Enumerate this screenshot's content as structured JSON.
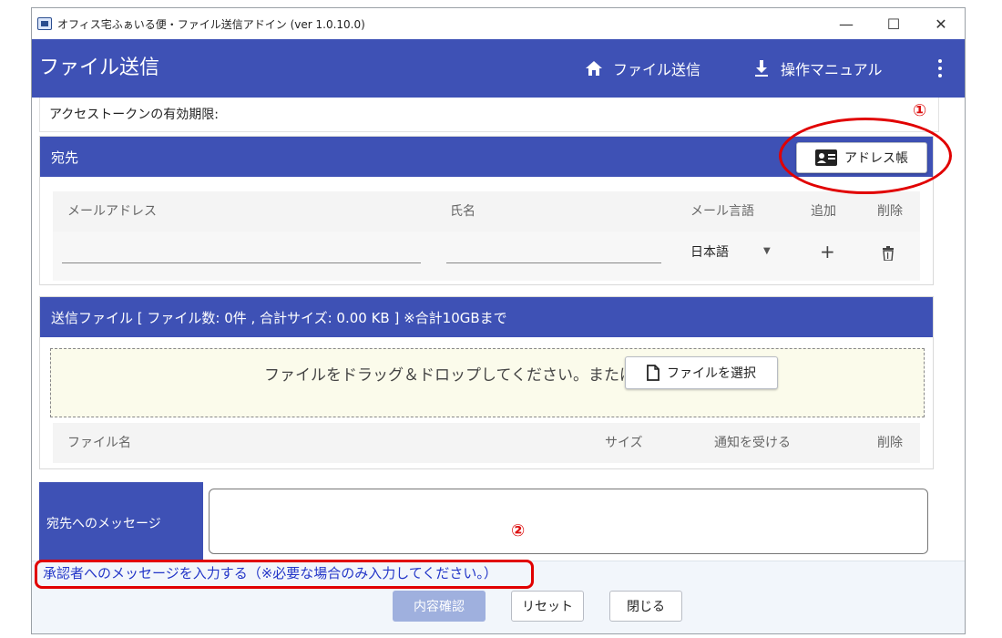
{
  "window": {
    "title": "オフィス宅ふぁいる便・ファイル送信アドイン (ver 1.0.10.0)",
    "controls": {
      "minimize": "—",
      "maximize": "☐",
      "close": "✕"
    }
  },
  "appbar": {
    "title": "ファイル送信",
    "nav": [
      {
        "label": "ファイル送信",
        "icon": "home-icon"
      },
      {
        "label": "操作マニュアル",
        "icon": "download-icon"
      }
    ],
    "menu_icon": "more-vert-icon"
  },
  "token": {
    "label": "アクセストークンの有効期限:"
  },
  "annotations": {
    "one": "①",
    "two": "②",
    "color": "#e10000"
  },
  "recipients": {
    "header": "宛先",
    "address_book_button": "アドレス帳",
    "columns": [
      "メールアドレス",
      "氏名",
      "メール言語",
      "追加",
      "削除"
    ],
    "row": {
      "language": "日本語",
      "add": "+"
    }
  },
  "files": {
    "header": "送信ファイル [ ファイル数: 0件 , 合計サイズ: 0.00 KB ] ※合計10GBまで",
    "drop_text": "ファイルをドラッグ＆ドロップしてください。または、",
    "select_button": "ファイルを選択",
    "columns": [
      "ファイル名",
      "サイズ",
      "通知を受ける",
      "削除"
    ]
  },
  "message": {
    "label": "宛先へのメッセージ"
  },
  "footer": {
    "approver_link": "承認者へのメッセージを入力する（※必要な場合のみ入力してください。）",
    "buttons": {
      "confirm": "内容確認",
      "reset": "リセット",
      "close": "閉じる"
    }
  },
  "colors": {
    "primary": "#3e51b5",
    "link": "#2336c8",
    "disabled": "#9fb0de"
  }
}
